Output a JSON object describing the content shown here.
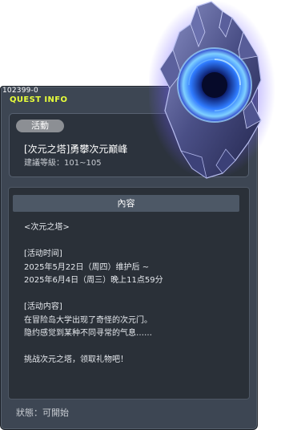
{
  "window": {
    "quest_id": "102399-0",
    "title": "QUEST INFO"
  },
  "summary": {
    "category": "活動",
    "quest_name": "[次元之塔]勇攀次元巅峰",
    "recommended_level": "建議等級：101~105"
  },
  "content": {
    "header": "內容",
    "lines": [
      "<次元之塔>",
      "",
      "[活动时间]",
      "2025年5月22日（周四）维护后 ~",
      "2025年6月4日（周三）晚上11点59分",
      "",
      "[活动内容]",
      "在冒险岛大学出现了奇怪的次元门。",
      "隐约感觉到某种不同寻常的气息……",
      "",
      "挑战次元之塔，领取礼物吧！"
    ]
  },
  "status": {
    "text": "狀態：可開始"
  },
  "artwork": {
    "icon": "dimension-portal-icon",
    "colors": {
      "glow": "#6f5cff",
      "core": "#2f7bff",
      "rock": "#4a4f86"
    }
  }
}
